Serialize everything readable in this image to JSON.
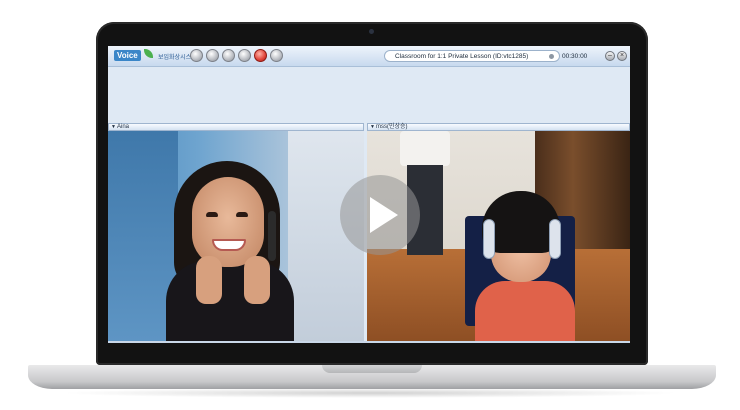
{
  "app": {
    "logo_text": "Voice",
    "subtitle": "보임화상시스템",
    "classroom_title": "Classroom for 1:1 Private Lesson (ID:vtc1285)",
    "timer": "00:30:00",
    "minimize_label": "–",
    "close_label": "×"
  },
  "panels": {
    "left_name": "Aina",
    "right_name": "mss(민상승)"
  },
  "icons": {
    "play": "play-icon",
    "toolbar": [
      "toolbar-button-icon",
      "toolbar-button-icon",
      "toolbar-button-icon",
      "toolbar-button-icon",
      "record-button-icon",
      "toolbar-button-icon"
    ]
  },
  "colors": {
    "accent": "#3a86c8",
    "record": "#e0433a"
  }
}
